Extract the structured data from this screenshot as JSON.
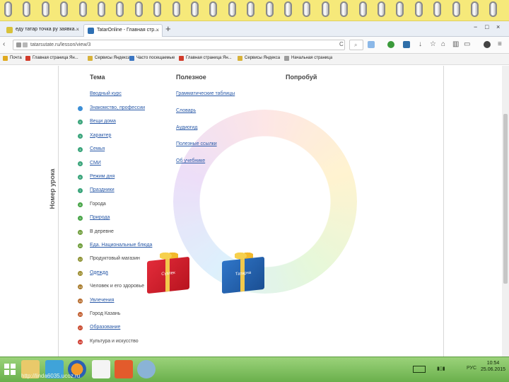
{
  "tabs": [
    {
      "label": "еду татар точка ру заявка...",
      "active": false
    },
    {
      "label": "TatarOnline - Главная стр...",
      "active": true
    }
  ],
  "window_controls": {
    "minimize": "−",
    "maximize": "□",
    "close": "×"
  },
  "address": {
    "url": "tatarsutate.ru/lesson/view/3"
  },
  "bookmarks": [
    "Почта",
    "Главная страница Ян...",
    "Сервисы Яндекса",
    "Часто посещаемые",
    "Главная страница Ян...",
    "Сервисы Яндекса",
    "Начальная страница"
  ],
  "columns": {
    "theme": "Тема",
    "useful": "Полезное",
    "try": "Попробуй"
  },
  "side_label": "Номер урока",
  "intro_link": "Вводный курс",
  "lessons": [
    {
      "num": "",
      "label": "Знакомство, профессии",
      "color": "#3d8fd6",
      "link": true
    },
    {
      "num": "2",
      "label": "Вещи дома",
      "color": "#39a47a",
      "link": true
    },
    {
      "num": "3",
      "label": "Характер",
      "color": "#39a47a",
      "link": true
    },
    {
      "num": "4",
      "label": "Семья",
      "color": "#39a47a",
      "link": true
    },
    {
      "num": "5",
      "label": "СМИ",
      "color": "#39a47a",
      "link": true
    },
    {
      "num": "6",
      "label": "Режим дня",
      "color": "#39a47a",
      "link": true
    },
    {
      "num": "7",
      "label": "Праздники",
      "color": "#39a47a",
      "link": true
    },
    {
      "num": "8",
      "label": "Города",
      "color": "#48a548",
      "link": false
    },
    {
      "num": "9",
      "label": "Природа",
      "color": "#48a548",
      "link": true
    },
    {
      "num": "10",
      "label": "В деревне",
      "color": "#6b9b36",
      "link": false
    },
    {
      "num": "11",
      "label": "Еда. Национальные блюда",
      "color": "#6b9b36",
      "link": true
    },
    {
      "num": "12",
      "label": "Продуктовый магазин",
      "color": "#8a8f2d",
      "link": false
    },
    {
      "num": "13",
      "label": "Одежда",
      "color": "#9a8a2a",
      "link": true
    },
    {
      "num": "14",
      "label": "Человек и его здоровье",
      "color": "#a77a2a",
      "link": false
    },
    {
      "num": "15",
      "label": "Увлечения",
      "color": "#b66a2a",
      "link": true
    },
    {
      "num": "16",
      "label": "Город Казань",
      "color": "#c05a2a",
      "link": false
    },
    {
      "num": "17",
      "label": "Образование",
      "color": "#c9482c",
      "link": true
    },
    {
      "num": "18",
      "label": "Культура и искусство",
      "color": "#cf3a2e",
      "link": false
    }
  ],
  "useful_links": [
    "Грамматические таблицы",
    "Словарь",
    "Аудиогид",
    "Полезные ссылки",
    "Об учебнике"
  ],
  "gifts": {
    "red_label": "Сүзлек",
    "blue_label": "Татарча"
  },
  "taskbar": {
    "lang": "РУС",
    "time": "10:54",
    "date": "25.06.2015",
    "site": "http://linda6035.ucoz.ru"
  }
}
